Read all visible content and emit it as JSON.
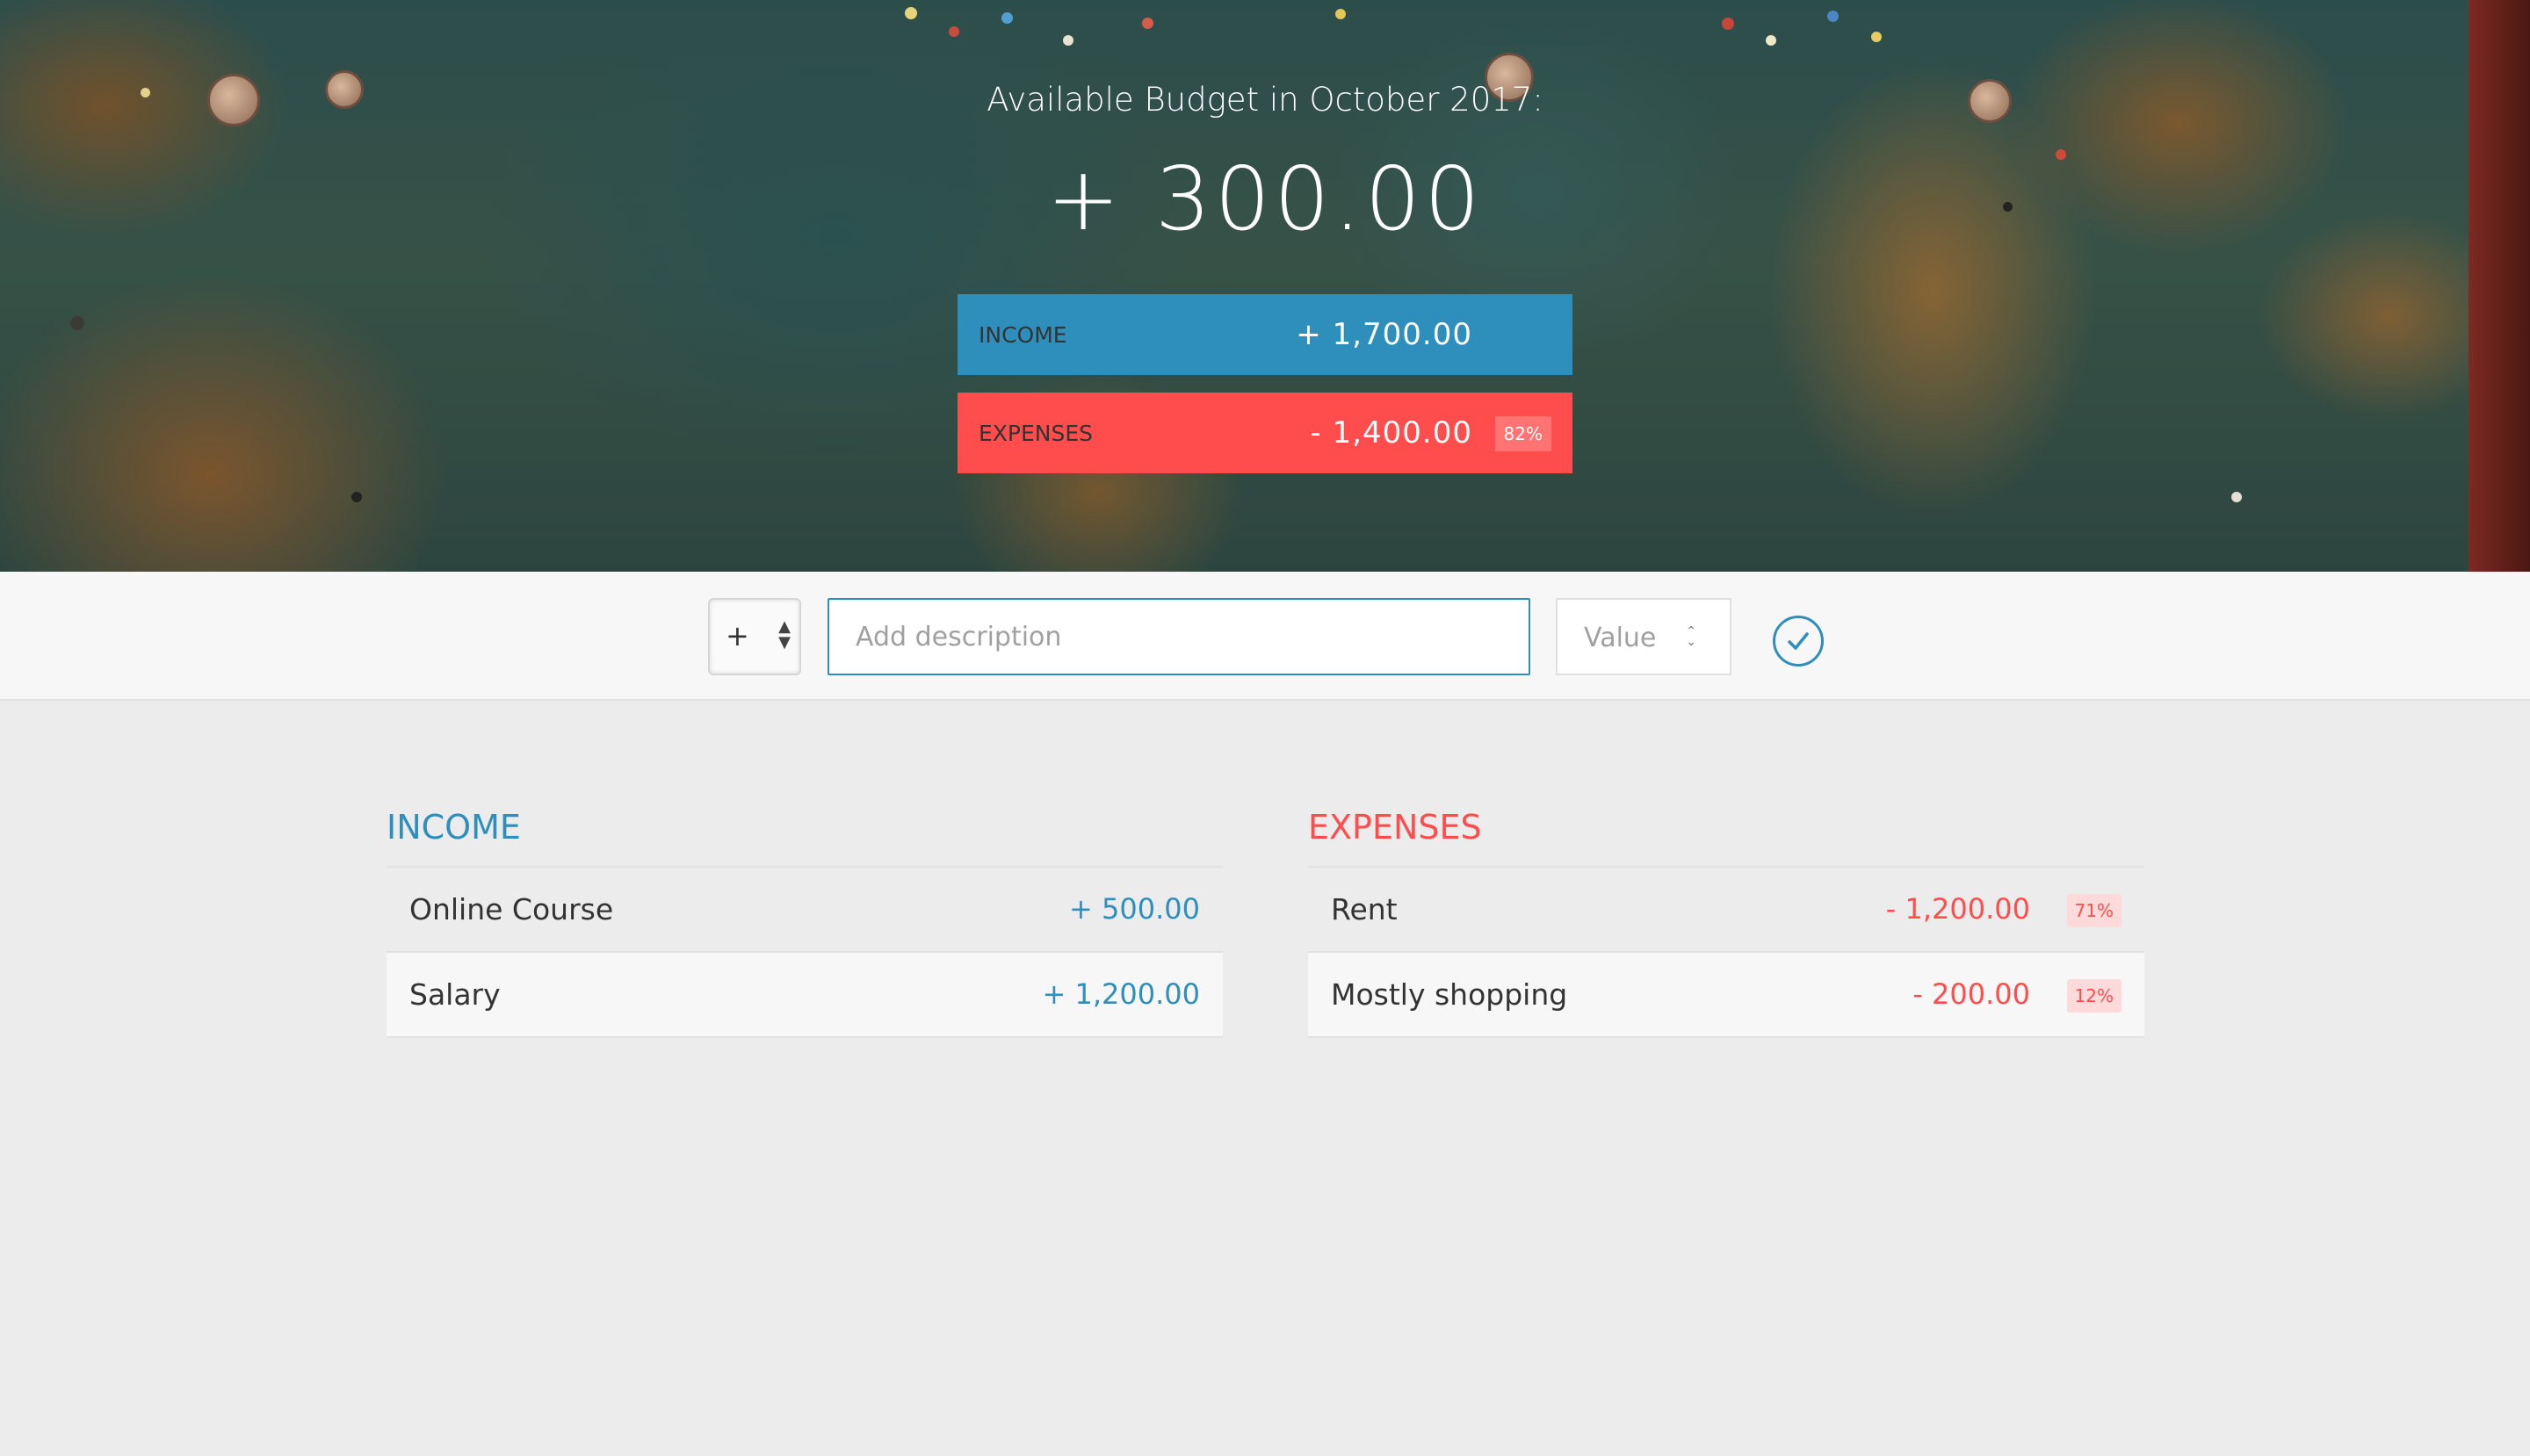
{
  "header": {
    "title": "Available Budget in October 2017:",
    "budget": "+ 300.00",
    "income": {
      "label": "INCOME",
      "value": "+ 1,700.00"
    },
    "expenses": {
      "label": "EXPENSES",
      "value": "- 1,400.00",
      "percentage": "82%"
    }
  },
  "add_bar": {
    "type_selected": "+",
    "description_placeholder": "Add description",
    "value_placeholder": "Value",
    "submit_icon": "check-circle-icon"
  },
  "income_list": {
    "title": "INCOME",
    "items": [
      {
        "description": "Online Course",
        "value": "+ 500.00"
      },
      {
        "description": "Salary",
        "value": "+ 1,200.00"
      }
    ]
  },
  "expenses_list": {
    "title": "EXPENSES",
    "items": [
      {
        "description": "Rent",
        "value": "- 1,200.00",
        "percentage": "71%"
      },
      {
        "description": "Mostly shopping",
        "value": "- 200.00",
        "percentage": "12%"
      }
    ]
  },
  "colors": {
    "income": "#2e8fbc",
    "expenses": "#ff4c4c",
    "background": "#ececec"
  }
}
